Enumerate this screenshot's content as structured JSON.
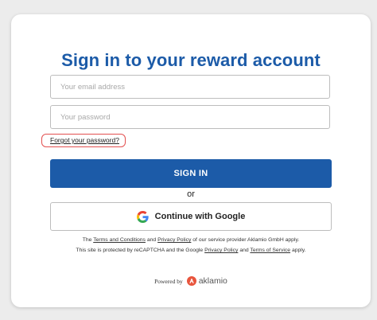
{
  "title": "Sign in to your reward account",
  "email": {
    "placeholder": "Your email address",
    "value": ""
  },
  "password": {
    "placeholder": "Your password",
    "value": ""
  },
  "forgot_label": "Forgot your password?",
  "signin_label": "SIGN IN",
  "or_label": "or",
  "google_label": "Continue with Google",
  "legal": {
    "line1": {
      "prefix": "The",
      "terms_link": "Terms and Conditions",
      "and": "and",
      "privacy_link": "Privacy Policy",
      "suffix": "of our service provider Aklamio GmbH apply."
    },
    "line2": {
      "prefix": "This site is protected by reCAPTCHA and the Google",
      "privacy_link": "Privacy Policy",
      "and": "and",
      "terms_link": "Terms of Service",
      "suffix": "apply."
    }
  },
  "powered": {
    "text": "Powered by",
    "brand": "aklamio"
  },
  "colors": {
    "primary": "#1c5ba8",
    "highlight_outline": "#e35050",
    "brand_orange": "#e8553d"
  },
  "icons": {
    "google": "google-g-icon",
    "brand": "aklamio-logo-icon"
  }
}
